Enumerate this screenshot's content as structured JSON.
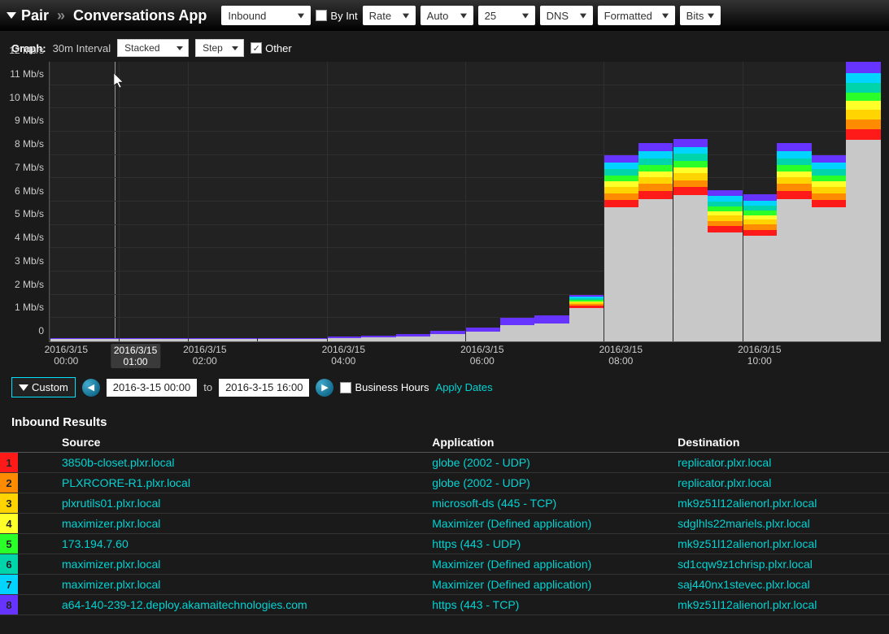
{
  "topbar": {
    "title_left": "Pair",
    "title_right": "Conversations App",
    "direction": "Inbound",
    "byint_label": "By Int",
    "rate": "Rate",
    "auto": "Auto",
    "count": "25",
    "lookup": "DNS",
    "format": "Formatted",
    "units": "Bits"
  },
  "graph_controls": {
    "label": "Graph:",
    "interval": "30m Interval",
    "stack": "Stacked",
    "step": "Step",
    "other_label": "Other",
    "other_checked": true
  },
  "chart_data": {
    "type": "area",
    "ylabel_unit": "Mb/s",
    "ylim": [
      0,
      12
    ],
    "yticks": [
      0,
      1,
      2,
      3,
      4,
      5,
      6,
      7,
      8,
      9,
      10,
      11,
      12
    ],
    "x": [
      "00:00",
      "00:30",
      "01:00",
      "01:30",
      "02:00",
      "02:30",
      "03:00",
      "03:30",
      "04:00",
      "04:30",
      "05:00",
      "05:30",
      "06:00",
      "06:30",
      "07:00",
      "07:30",
      "08:00",
      "08:30",
      "09:00",
      "09:30",
      "10:00",
      "10:30",
      "11:00",
      "11:30"
    ],
    "xticks_visible": [
      "00:00",
      "01:00",
      "02:00",
      "04:00",
      "06:00",
      "08:00",
      "10:00"
    ],
    "date_prefix": "2016/3/15",
    "highlight_xtick": "01:00",
    "series": [
      {
        "name": "Other",
        "color": "#c8c8c8"
      },
      {
        "name": "1",
        "color": "#ff1a1a"
      },
      {
        "name": "2",
        "color": "#ff8c00"
      },
      {
        "name": "3",
        "color": "#ffd400"
      },
      {
        "name": "4",
        "color": "#ffff2a"
      },
      {
        "name": "5",
        "color": "#2aff2a"
      },
      {
        "name": "6",
        "color": "#00d4aa"
      },
      {
        "name": "7",
        "color": "#00d4ff"
      },
      {
        "name": "8",
        "color": "#6633ff"
      }
    ],
    "stacked_totals": [
      0.15,
      0.15,
      0.15,
      0.15,
      0.15,
      0.15,
      0.15,
      0.15,
      0.2,
      0.25,
      0.3,
      0.45,
      0.6,
      1.0,
      1.1,
      2.0,
      8.0,
      8.5,
      8.7,
      6.5,
      6.3,
      8.5,
      8.0,
      12.0
    ],
    "stack_fractions_when_tall": {
      "Other": 0.72,
      "8": 0.04,
      "7": 0.035,
      "6": 0.035,
      "5": 0.03,
      "4": 0.03,
      "3": 0.035,
      "2": 0.035,
      "1": 0.04
    }
  },
  "date_bar": {
    "custom": "Custom",
    "from": "2016-3-15 00:00",
    "to_label": "to",
    "to": "2016-3-15 16:00",
    "bh_label": "Business Hours",
    "apply": "Apply Dates"
  },
  "results": {
    "title": "Inbound Results",
    "columns": [
      "Source",
      "Application",
      "Destination"
    ],
    "rows": [
      {
        "rank": 1,
        "color": "#ff1a1a",
        "source": "3850b-closet.plxr.local",
        "app": "globe (2002 - UDP)",
        "dest": "replicator.plxr.local"
      },
      {
        "rank": 2,
        "color": "#ff8c00",
        "source": "PLXRCORE-R1.plxr.local",
        "app": "globe (2002 - UDP)",
        "dest": "replicator.plxr.local"
      },
      {
        "rank": 3,
        "color": "#ffd400",
        "source": "plxrutils01.plxr.local",
        "app": "microsoft-ds (445 - TCP)",
        "dest": "mk9z51l12alienorl.plxr.local"
      },
      {
        "rank": 4,
        "color": "#ffff2a",
        "source": "maximizer.plxr.local",
        "app": "Maximizer (Defined application)",
        "dest": "sdglhls22mariels.plxr.local"
      },
      {
        "rank": 5,
        "color": "#2aff2a",
        "source": "173.194.7.60",
        "app": "https (443 - UDP)",
        "dest": "mk9z51l12alienorl.plxr.local"
      },
      {
        "rank": 6,
        "color": "#00d4aa",
        "source": "maximizer.plxr.local",
        "app": "Maximizer (Defined application)",
        "dest": "sd1cqw9z1chrisp.plxr.local"
      },
      {
        "rank": 7,
        "color": "#00d4ff",
        "source": "maximizer.plxr.local",
        "app": "Maximizer (Defined application)",
        "dest": "saj440nx1stevec.plxr.local"
      },
      {
        "rank": 8,
        "color": "#6633ff",
        "source": "a64-140-239-12.deploy.akamaitechnologies.com",
        "app": "https (443 - TCP)",
        "dest": "mk9z51l12alienorl.plxr.local"
      }
    ]
  }
}
